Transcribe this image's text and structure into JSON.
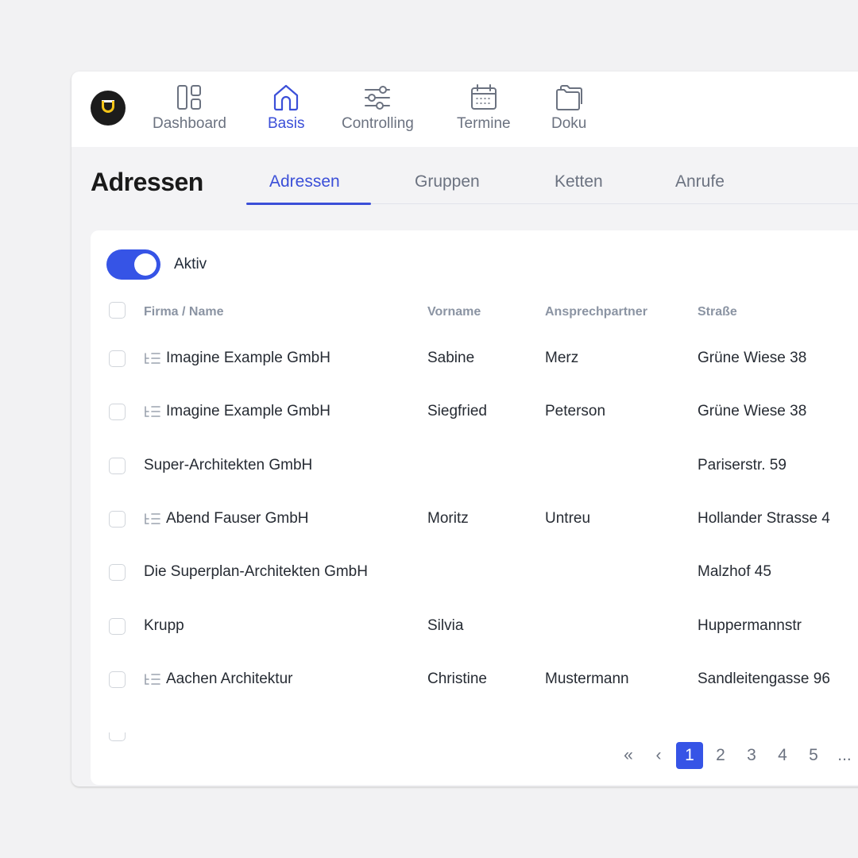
{
  "nav": {
    "items": [
      {
        "label": "Dashboard",
        "icon": "dashboard-icon"
      },
      {
        "label": "Basis",
        "icon": "home-icon"
      },
      {
        "label": "Controlling",
        "icon": "sliders-icon"
      },
      {
        "label": "Termine",
        "icon": "calendar-icon"
      },
      {
        "label": "Doku",
        "icon": "folder-icon"
      }
    ],
    "active": "Basis"
  },
  "page": {
    "title": "Adressen",
    "tabs": [
      "Adressen",
      "Gruppen",
      "Ketten",
      "Anrufe"
    ],
    "active_tab": "Adressen"
  },
  "filter": {
    "toggle_label": "Aktiv",
    "toggle_on": true
  },
  "table": {
    "columns": [
      "Firma / Name",
      "Vorname",
      "Ansprechpartner",
      "Straße"
    ],
    "rows": [
      {
        "firma": "Imagine Example GmbH",
        "vorname": "Sabine",
        "ansprechpartner": "Merz",
        "strasse": "Grüne Wiese 38",
        "has_children": true
      },
      {
        "firma": "Imagine Example GmbH",
        "vorname": "Siegfried",
        "ansprechpartner": "Peterson",
        "strasse": "Grüne Wiese 38",
        "has_children": true
      },
      {
        "firma": "Super-Architekten GmbH",
        "vorname": "",
        "ansprechpartner": "",
        "strasse": "Pariserstr. 59",
        "has_children": false
      },
      {
        "firma": "Abend Fauser GmbH",
        "vorname": "Moritz",
        "ansprechpartner": "Untreu",
        "strasse": "Hollander Strasse 4",
        "has_children": true
      },
      {
        "firma": "Die Superplan-Architekten GmbH",
        "vorname": "",
        "ansprechpartner": "",
        "strasse": "Malzhof 45",
        "has_children": false
      },
      {
        "firma": "Krupp",
        "vorname": "Silvia",
        "ansprechpartner": "",
        "strasse": "Huppermannstr",
        "has_children": false
      },
      {
        "firma": "Aachen Architektur",
        "vorname": "Christine",
        "ansprechpartner": "Mustermann",
        "strasse": "Sandleitengasse 96",
        "has_children": true
      }
    ]
  },
  "pagination": {
    "first": "«",
    "prev": "‹",
    "pages": [
      "1",
      "2",
      "3",
      "4",
      "5"
    ],
    "current": "1",
    "ellipsis": "..."
  },
  "colors": {
    "accent": "#3654e6",
    "accent_text": "#3b4fd8",
    "logo_bg": "#1c1c1c",
    "logo_mark": "#f5c518"
  }
}
